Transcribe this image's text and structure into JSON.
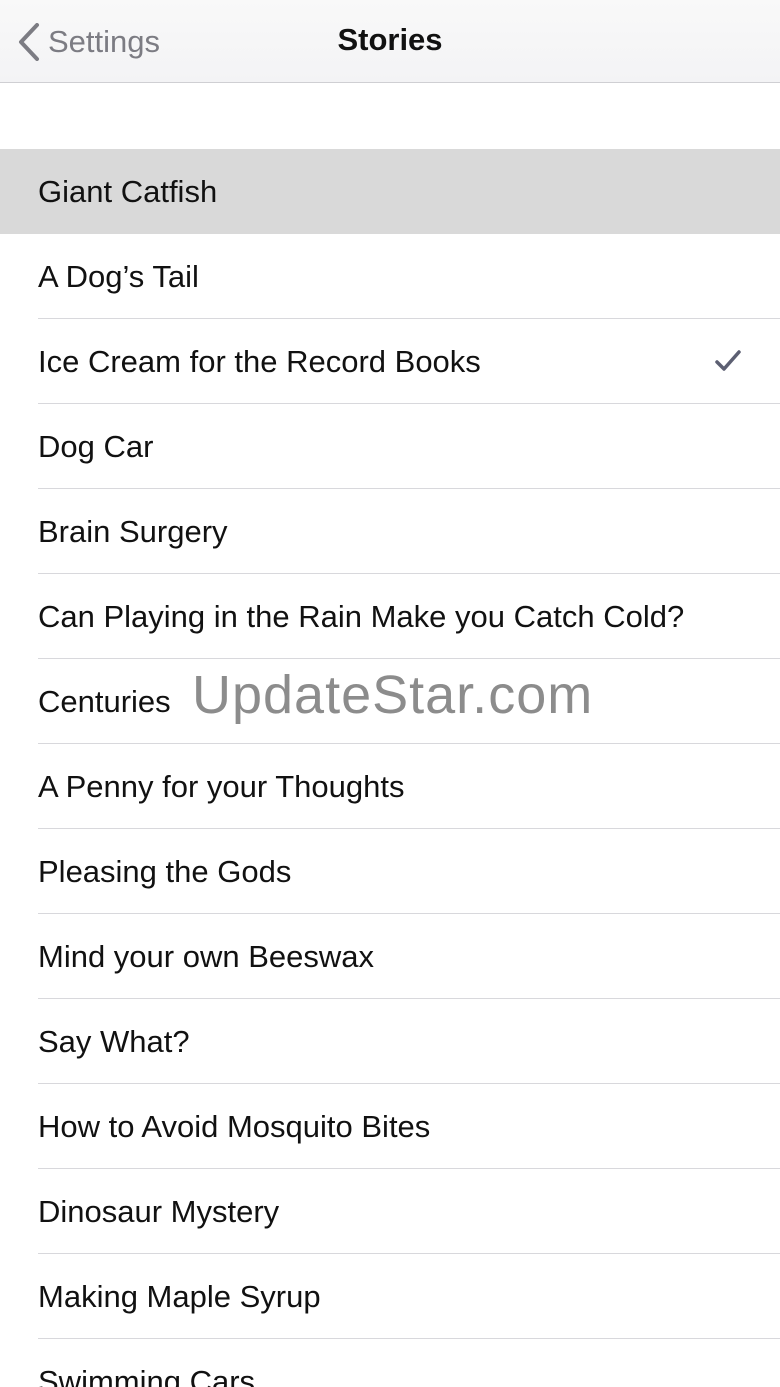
{
  "navbar": {
    "back_label": "Settings",
    "title": "Stories",
    "back_icon": "chevron-left-icon"
  },
  "stories": [
    {
      "label": "Giant Catfish",
      "highlighted": true,
      "checked": false
    },
    {
      "label": "A Dog’s Tail",
      "highlighted": false,
      "checked": false
    },
    {
      "label": "Ice Cream for the Record Books",
      "highlighted": false,
      "checked": true
    },
    {
      "label": "Dog Car",
      "highlighted": false,
      "checked": false
    },
    {
      "label": "Brain Surgery",
      "highlighted": false,
      "checked": false
    },
    {
      "label": "Can Playing in the Rain Make you Catch Cold?",
      "highlighted": false,
      "checked": false
    },
    {
      "label": "Centuries",
      "highlighted": false,
      "checked": false
    },
    {
      "label": "A Penny for your Thoughts",
      "highlighted": false,
      "checked": false
    },
    {
      "label": "Pleasing the Gods",
      "highlighted": false,
      "checked": false
    },
    {
      "label": "Mind your own Beeswax",
      "highlighted": false,
      "checked": false
    },
    {
      "label": "Say What?",
      "highlighted": false,
      "checked": false
    },
    {
      "label": "How to Avoid Mosquito Bites",
      "highlighted": false,
      "checked": false
    },
    {
      "label": "Dinosaur Mystery",
      "highlighted": false,
      "checked": false
    },
    {
      "label": "Making Maple Syrup",
      "highlighted": false,
      "checked": false
    },
    {
      "label": "Swimming Cars",
      "highlighted": false,
      "checked": false
    }
  ],
  "check_icon": "checkmark-icon",
  "watermark": "UpdateStar.com",
  "colors": {
    "highlight": "#d9d9d9",
    "checkmark": "#5c5f72",
    "back_tint": "#7c7c83"
  }
}
